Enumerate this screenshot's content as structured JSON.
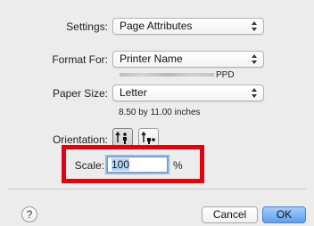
{
  "settings": {
    "label": "Settings:",
    "value": "Page Attributes"
  },
  "format_for": {
    "label": "Format For:",
    "value": "Printer Name",
    "sub": "PPD"
  },
  "paper_size": {
    "label": "Paper Size:",
    "value": "Letter",
    "sub": "8.50 by 11.00 inches"
  },
  "orientation": {
    "label": "Orientation:",
    "selected": "portrait"
  },
  "scale": {
    "label": "Scale:",
    "value": "100",
    "unit": "%"
  },
  "buttons": {
    "help": "?",
    "cancel": "Cancel",
    "ok": "OK"
  },
  "colors": {
    "highlight": "#e3000f",
    "default_button": "#5d9ff0"
  }
}
